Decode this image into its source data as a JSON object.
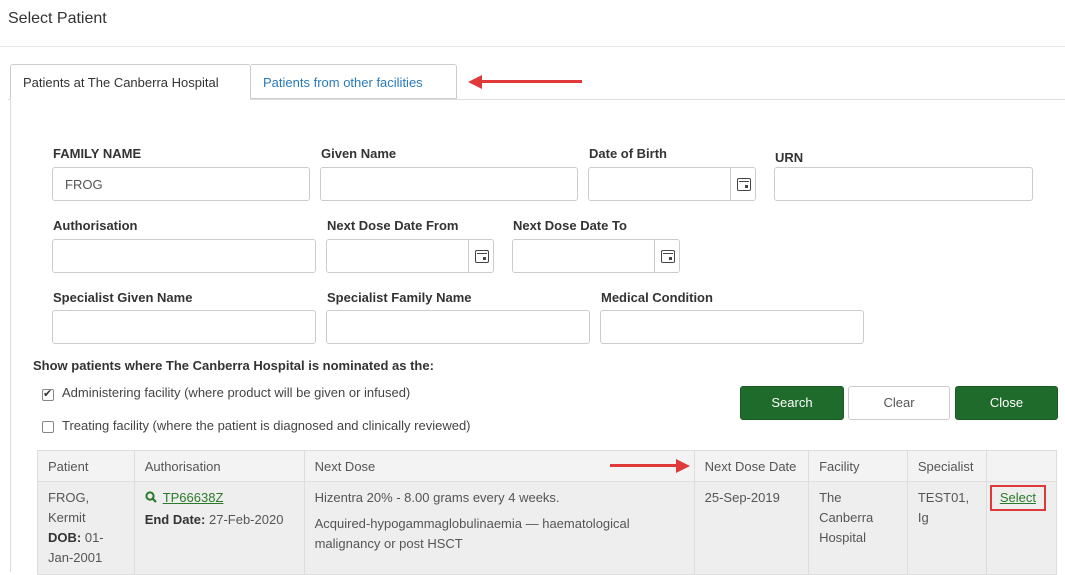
{
  "page_title": "Select Patient",
  "tabs": [
    {
      "label": "Patients at The Canberra Hospital",
      "active": true
    },
    {
      "label": "Patients from other facilities",
      "active": false
    }
  ],
  "form": {
    "family_name": {
      "label": "FAMILY NAME",
      "value": "FROG"
    },
    "given_name": {
      "label": "Given Name",
      "value": ""
    },
    "dob": {
      "label": "Date of Birth",
      "value": ""
    },
    "urn": {
      "label": "URN",
      "value": ""
    },
    "authorisation": {
      "label": "Authorisation",
      "value": ""
    },
    "next_dose_from": {
      "label": "Next Dose Date From",
      "value": ""
    },
    "next_dose_to": {
      "label": "Next Dose Date To",
      "value": ""
    },
    "specialist_given": {
      "label": "Specialist Given Name",
      "value": ""
    },
    "specialist_family": {
      "label": "Specialist Family Name",
      "value": ""
    },
    "medical_condition": {
      "label": "Medical Condition",
      "value": ""
    }
  },
  "nomination": {
    "heading": "Show patients where The Canberra Hospital is nominated as the:",
    "administering": {
      "label": "Administering facility (where product will be given or infused)",
      "checked": true
    },
    "treating": {
      "label": "Treating facility (where the patient is diagnosed and clinically reviewed)",
      "checked": false
    }
  },
  "buttons": {
    "search": "Search",
    "clear": "Clear",
    "close": "Close"
  },
  "table": {
    "headers": [
      "Patient",
      "Authorisation",
      "Next Dose",
      "Next Dose Date",
      "Facility",
      "Specialist",
      ""
    ],
    "rows": [
      {
        "patient_name_1": "FROG,",
        "patient_name_2": "Kermit",
        "dob_label": "DOB:",
        "dob_value_1": "01-",
        "dob_value_2": "Jan-2001",
        "auth_code": "TP66638Z",
        "end_label": "End Date:",
        "end_value": "27-Feb-2020",
        "next_dose_1": "Hizentra 20% - 8.00 grams every 4 weeks.",
        "next_dose_2": "Acquired-hypogammaglobulinaemia — haematological malignancy or post HSCT",
        "next_dose_date": "25-Sep-2019",
        "facility": "The Canberra Hospital",
        "specialist_1": "TEST01,",
        "specialist_2": "Ig",
        "action": "Select"
      }
    ]
  },
  "colors": {
    "accent_green": "#1f6b2b",
    "link_blue": "#2a7ab8",
    "annotation_red": "#e0393a"
  }
}
